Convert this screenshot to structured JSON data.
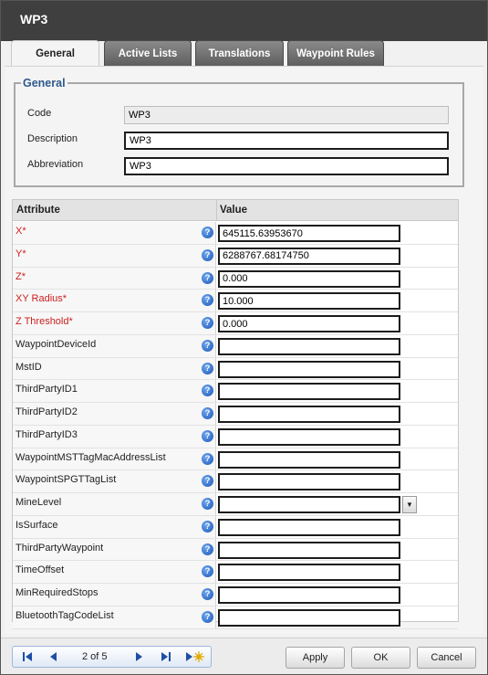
{
  "window": {
    "title": "WP3"
  },
  "tabs": [
    {
      "label": "General"
    },
    {
      "label": "Active Lists"
    },
    {
      "label": "Translations"
    },
    {
      "label": "Waypoint Rules"
    }
  ],
  "general": {
    "legend": "General",
    "code": {
      "label": "Code",
      "value": "WP3"
    },
    "description": {
      "label": "Description",
      "value": "WP3"
    },
    "abbreviation": {
      "label": "Abbreviation",
      "value": "WP3"
    }
  },
  "grid": {
    "header": {
      "attribute": "Attribute",
      "value": "Value"
    },
    "help_glyph": "?",
    "dropdown_glyph": "▼",
    "rows": [
      {
        "label": "X*",
        "value": "645115.63953670",
        "required": true
      },
      {
        "label": "Y*",
        "value": "6288767.68174750",
        "required": true
      },
      {
        "label": "Z*",
        "value": "0.000",
        "required": true
      },
      {
        "label": "XY Radius*",
        "value": "10.000",
        "required": true
      },
      {
        "label": "Z Threshold*",
        "value": "0.000",
        "required": true
      },
      {
        "label": "WaypointDeviceId",
        "value": ""
      },
      {
        "label": "MstID",
        "value": ""
      },
      {
        "label": "ThirdPartyID1",
        "value": ""
      },
      {
        "label": "ThirdPartyID2",
        "value": ""
      },
      {
        "label": "ThirdPartyID3",
        "value": ""
      },
      {
        "label": "WaypointMSTTagMacAddressList",
        "value": ""
      },
      {
        "label": "WaypointSPGTTagList",
        "value": ""
      },
      {
        "label": "MineLevel",
        "value": "",
        "dropdown": true
      },
      {
        "label": "IsSurface",
        "value": ""
      },
      {
        "label": "ThirdPartyWaypoint",
        "value": ""
      },
      {
        "label": "TimeOffset",
        "value": ""
      },
      {
        "label": "MinRequiredStops",
        "value": ""
      },
      {
        "label": "BluetoothTagCodeList",
        "value": ""
      }
    ]
  },
  "pager": {
    "text": "2 of 5"
  },
  "buttons": {
    "apply": "Apply",
    "ok": "OK",
    "cancel": "Cancel"
  },
  "colors": {
    "titlebar": "#3f3f3f",
    "legend": "#2e5a8c",
    "required_label": "#cc1f1f",
    "help_icon": "#1a56b8",
    "pager_icon": "#1d4fa6"
  }
}
